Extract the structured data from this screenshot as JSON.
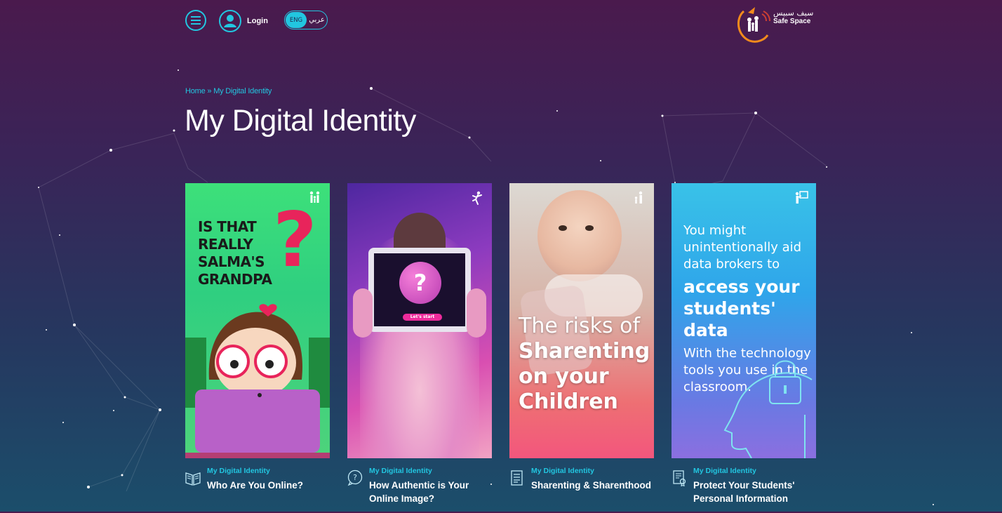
{
  "header": {
    "login_label": "Login",
    "lang_eng": "ENG",
    "lang_ar": "عربي",
    "logo_ar": "سيف سبيس",
    "logo_en": "Safe Space"
  },
  "breadcrumb": {
    "home": "Home",
    "sep": " » ",
    "current": "My Digital Identity"
  },
  "page": {
    "title": "My Digital Identity"
  },
  "cards": [
    {
      "category": "My Digital Identity",
      "title": "Who Are You Online?",
      "image": {
        "lines": [
          "IS THAT",
          "REALLY",
          "SALMA'S",
          "GRANDPA"
        ],
        "mark": "?"
      }
    },
    {
      "category": "My Digital Identity",
      "title": "How Authentic is Your Online Image?",
      "image": {
        "mark": "?",
        "button": "Let's start"
      }
    },
    {
      "category": "My Digital Identity",
      "title": "Sharenting & Sharenthood",
      "image": {
        "line1": "The risks of",
        "line2": "Sharenting",
        "line3": "on your",
        "line4": "Children"
      }
    },
    {
      "category": "My Digital Identity",
      "title": "Protect Your Students' Personal Information",
      "image": {
        "intro": "You might unintentionally aid data brokers to",
        "bold": "access your students' data",
        "outro": "With the technology tools you use in the classroom."
      }
    }
  ],
  "icons": {
    "menu": "hamburger-menu-icon",
    "login": "user-avatar-icon",
    "card1_badge": "family-icon",
    "card2_badge": "person-jumping-icon",
    "card3_badge": "parent-child-icon",
    "card4_badge": "teacher-board-icon",
    "card1_foot": "open-book-icon",
    "card2_foot": "question-bubble-icon",
    "card3_foot": "document-list-icon",
    "card4_foot": "certificate-icon"
  },
  "colors": {
    "accent": "#22c6e0",
    "bg_top": "#4a1a4d",
    "bg_bottom": "#1b4e6b"
  }
}
